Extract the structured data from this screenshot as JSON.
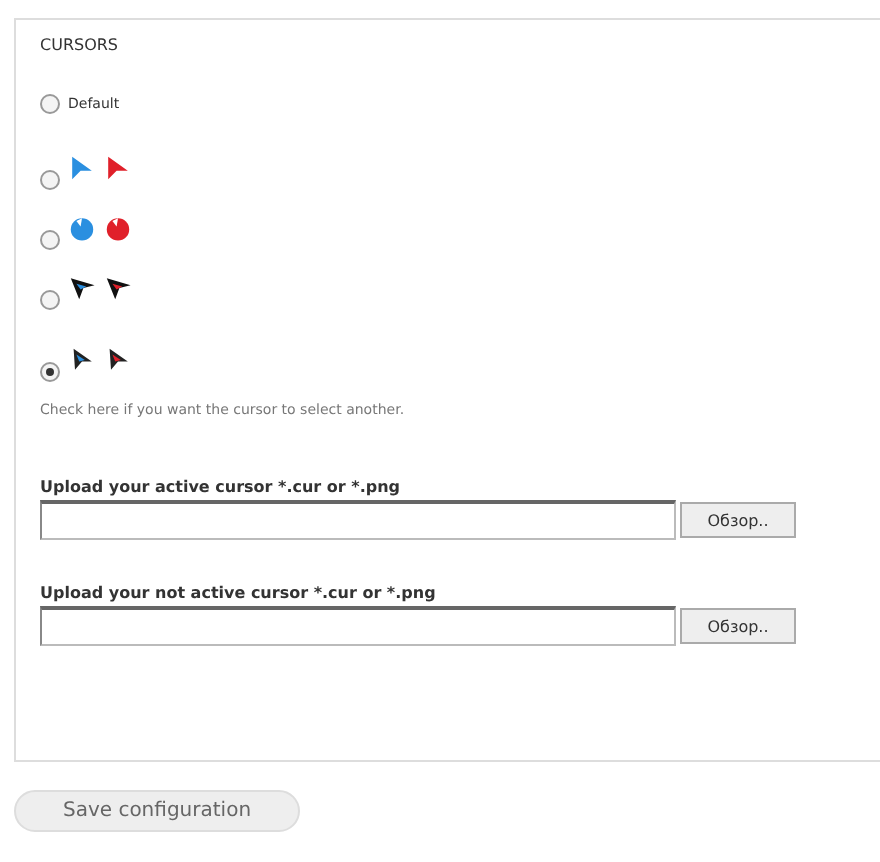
{
  "legend": "CURSORS",
  "options": [
    {
      "kind": "text",
      "label": "Default",
      "selected": false
    },
    {
      "kind": "arrow",
      "selected": false
    },
    {
      "kind": "blob",
      "selected": false
    },
    {
      "kind": "dart",
      "selected": false
    },
    {
      "kind": "thin",
      "selected": true
    }
  ],
  "description": "Check here if you want the cursor to select another.",
  "uploads": [
    {
      "label": "Upload your active cursor *.cur or *.png",
      "button": "Обзор.."
    },
    {
      "label": "Upload your not active cursor *.cur or *.png",
      "button": "Обзор.."
    }
  ],
  "save_button": "Save configuration"
}
